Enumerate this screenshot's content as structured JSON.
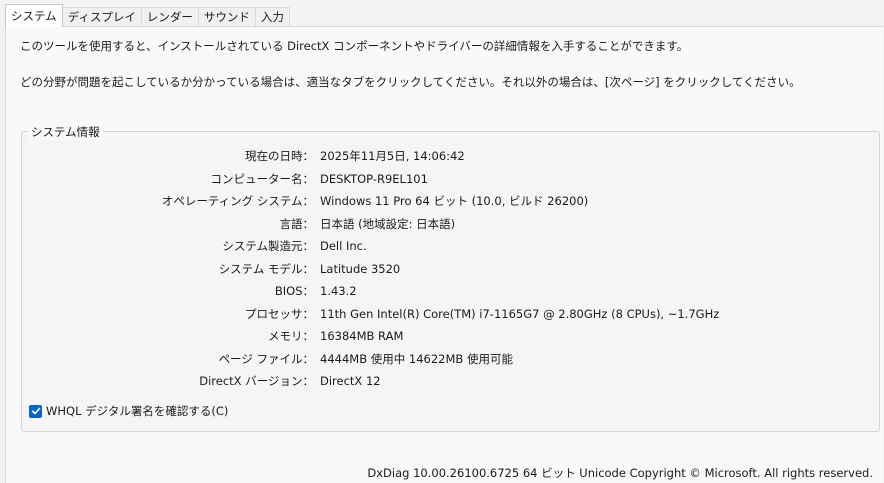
{
  "tabs": [
    {
      "label": "システム",
      "active": true
    },
    {
      "label": "ディスプレイ",
      "active": false
    },
    {
      "label": "レンダー",
      "active": false
    },
    {
      "label": "サウンド",
      "active": false
    },
    {
      "label": "入力",
      "active": false
    }
  ],
  "intro": {
    "line1": "このツールを使用すると、インストールされている DirectX コンポーネントやドライバーの詳細情報を入手することができます。",
    "line2": "どの分野が問題を起こしているか分かっている場合は、適当なタブをクリックしてください。それ以外の場合は、[次ページ] をクリックしてください。"
  },
  "system_info": {
    "title": "システム情報",
    "rows": [
      {
        "label": "現在の日時：",
        "value": "2025年11月5日, 14:06:42"
      },
      {
        "label": "コンピューター名：",
        "value": "DESKTOP-R9EL101"
      },
      {
        "label": "オペレーティング システム：",
        "value": "Windows 11 Pro 64 ビット (10.0, ビルド 26200)"
      },
      {
        "label": "言語：",
        "value": "日本語 (地域設定: 日本語)"
      },
      {
        "label": "システム製造元：",
        "value": "Dell Inc."
      },
      {
        "label": "システム モデル：",
        "value": "Latitude 3520"
      },
      {
        "label": "BIOS：",
        "value": "1.43.2"
      },
      {
        "label": "プロセッサ：",
        "value": "11th Gen Intel(R) Core(TM) i7-1165G7 @ 2.80GHz (8 CPUs), ~1.7GHz"
      },
      {
        "label": "メモリ：",
        "value": "16384MB RAM"
      },
      {
        "label": "ページ ファイル：",
        "value": "4444MB 使用中 14622MB 使用可能"
      },
      {
        "label": "DirectX バージョン：",
        "value": "DirectX 12"
      }
    ]
  },
  "whql_checkbox": {
    "label": "WHQL デジタル署名を確認する(C)",
    "checked": true
  },
  "footer": "DxDiag 10.00.26100.6725 64 ビット Unicode  Copyright © Microsoft. All rights reserved.",
  "colors": {
    "checkbox_accent": "#0a64c8"
  }
}
